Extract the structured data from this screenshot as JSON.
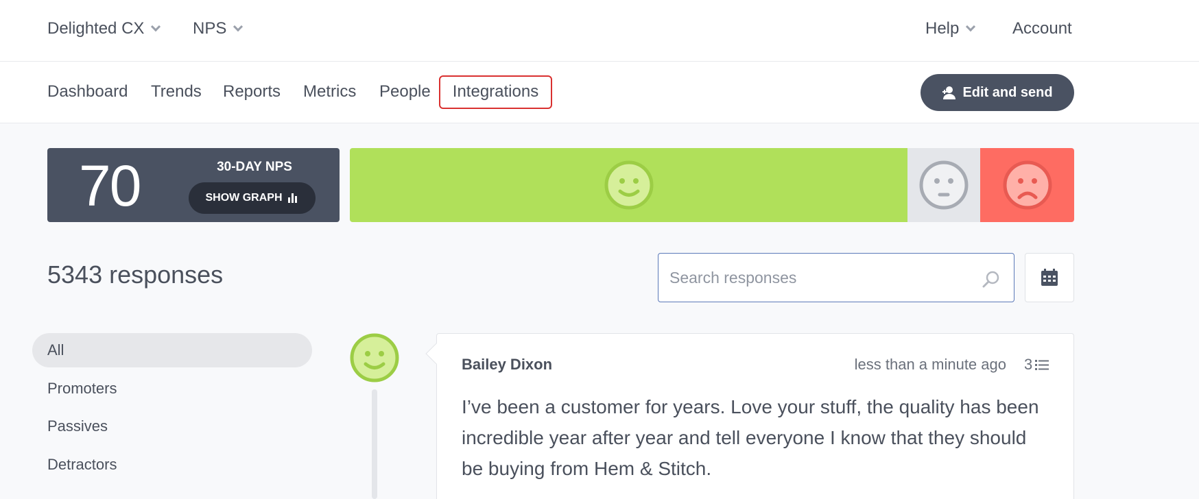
{
  "topbar": {
    "brand": "Delighted CX",
    "survey": "NPS",
    "help": "Help",
    "account": "Account"
  },
  "nav": {
    "items": [
      "Dashboard",
      "Trends",
      "Reports",
      "Metrics",
      "People",
      "Integrations"
    ],
    "highlighted": "Integrations",
    "edit_send": "Edit and send"
  },
  "nps": {
    "score": "70",
    "label": "30-DAY NPS",
    "show_graph": "SHOW GRAPH",
    "distribution": {
      "promoters": 0.77,
      "passives": 0.1,
      "detractors": 0.13
    },
    "colors": {
      "promoters": "#b0e05a",
      "passives": "#e4e6ea",
      "detractors": "#fe6c62"
    }
  },
  "responses": {
    "count_label": "5343 responses",
    "search_placeholder": "Search responses"
  },
  "filters": [
    "All",
    "Promoters",
    "Passives",
    "Detractors"
  ],
  "response_card": {
    "person": "Bailey Dixon",
    "time": "less than a minute ago",
    "count": "3",
    "comment": "I’ve been a customer for years. Love your stuff, the quality has been incredible year after year and tell everyone I know that they should be buying from Hem & Stitch."
  }
}
